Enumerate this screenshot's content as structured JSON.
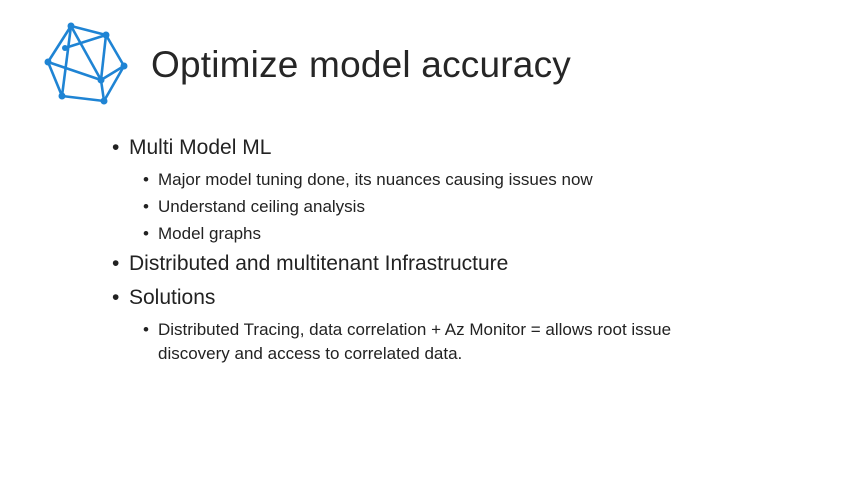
{
  "slide": {
    "title": "Optimize model accuracy",
    "logo_icon": "polygon-network-icon",
    "accent_color": "#1f84d4",
    "bullets": [
      {
        "text": "Multi Model ML",
        "sub": [
          "Major model tuning done, its nuances causing issues now",
          "Understand ceiling analysis",
          "Model graphs"
        ]
      },
      {
        "text": "Distributed and multitenant Infrastructure"
      },
      {
        "text": "Solutions",
        "sub": [
          "Distributed Tracing, data correlation + Az Monitor = allows root issue discovery and access to correlated data."
        ]
      }
    ]
  }
}
